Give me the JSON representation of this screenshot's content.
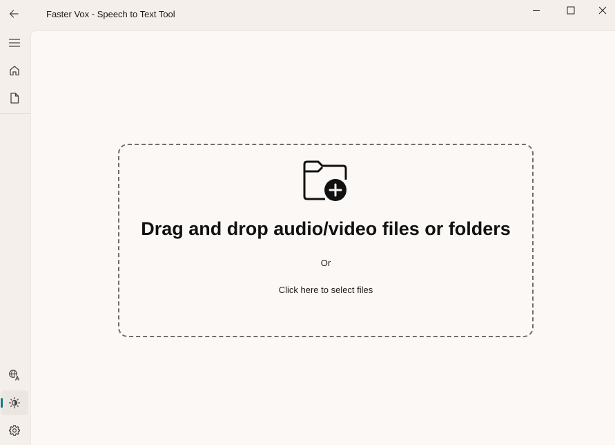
{
  "window": {
    "title": "Faster Vox - Speech to Text Tool",
    "controls": [
      "minimize-icon",
      "maximize-icon",
      "close-icon"
    ]
  },
  "sidebar": {
    "items": [
      {
        "name": "menu",
        "icon": "hamburger-menu-icon"
      },
      {
        "name": "home",
        "icon": "home-icon"
      },
      {
        "name": "files",
        "icon": "document-icon"
      },
      {
        "name": "language",
        "icon": "translate-icon"
      },
      {
        "name": "theme",
        "icon": "brightness-icon",
        "selected": true
      },
      {
        "name": "settings",
        "icon": "gear-icon"
      }
    ],
    "accent": "#0f7b8a"
  },
  "dropzone": {
    "icon": "folder-add-icon",
    "heading": "Drag and drop audio/video files or folders",
    "or_text": "Or",
    "select_text": "Click here to select files"
  }
}
